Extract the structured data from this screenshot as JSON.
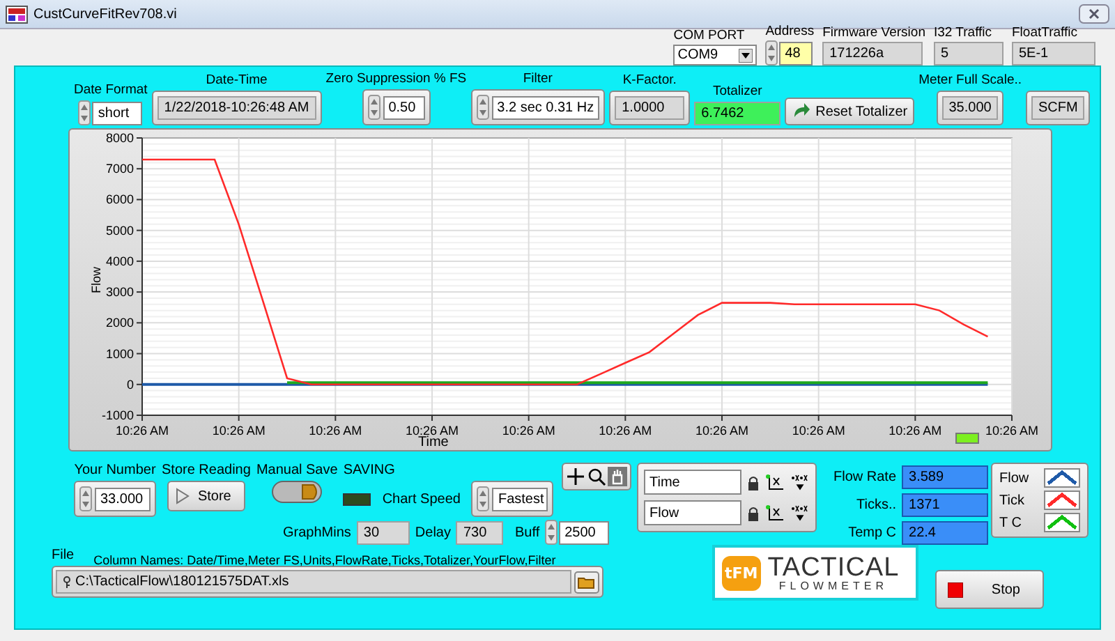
{
  "window": {
    "title": "CustCurveFitRev708.vi"
  },
  "header": [
    {
      "kind": "dropdown",
      "label": "COM PORT",
      "value": "COM9"
    },
    {
      "kind": "spin",
      "label": "Address",
      "value": "48"
    },
    {
      "kind": "readout",
      "label": "Firmware Version",
      "value": "171226a"
    },
    {
      "kind": "readout",
      "label": "I32 Traffic",
      "value": "5"
    },
    {
      "kind": "readout",
      "label": "FloatTraffic",
      "value": "5E-1"
    }
  ],
  "top_controls": [
    {
      "kind": "spin",
      "label": "Date Format",
      "value": "short"
    },
    {
      "kind": "readout",
      "label": "Date-Time",
      "value": "1/22/2018-10:26:48 AM"
    },
    {
      "kind": "spinbox",
      "label": "Zero Suppression % FS",
      "value": "0.50"
    },
    {
      "kind": "spinbox",
      "label": "Filter",
      "value": "3.2 sec 0.31 Hz"
    },
    {
      "kind": "readout",
      "label": "K-Factor.",
      "value": "1.0000"
    },
    {
      "kind": "highlight",
      "label": "Totalizer",
      "value": "6.7462"
    },
    {
      "kind": "button",
      "label": "Reset Totalizer"
    },
    {
      "kind": "readout",
      "label": "Meter Full Scale..",
      "value": "35.000"
    },
    {
      "kind": "readout",
      "value": "SCFM"
    }
  ],
  "chart": {
    "led_on": true,
    "chart_data": {
      "type": "line",
      "xlabel": "Time",
      "ylabel": "Flow",
      "categories": [
        "10:26 AM",
        null,
        null,
        null,
        "10:26 AM",
        null,
        null,
        null,
        "10:26 AM",
        null,
        null,
        null,
        "10:26 AM",
        null,
        null,
        null,
        "10:26 AM",
        null,
        null,
        null,
        "10:26 AM",
        null,
        null,
        null,
        "10:26 AM",
        null,
        null,
        null,
        "10:26 AM",
        null,
        null,
        null,
        "10:26 AM",
        null,
        null,
        null,
        "10:26 AM"
      ],
      "series": [
        {
          "color": "#1f5aa8",
          "values": [
            0,
            0,
            0,
            0,
            0,
            0,
            0,
            0,
            0,
            0,
            0,
            0,
            0,
            0,
            0,
            0,
            0,
            0,
            0,
            0,
            0,
            0,
            0,
            0,
            0,
            0,
            0,
            0,
            0,
            0,
            0,
            0,
            0,
            0,
            0,
            0,
            null
          ]
        },
        {
          "color": "#ff2a2a",
          "values": [
            7300,
            7300,
            7300,
            7300,
            5200,
            2700,
            200,
            0,
            0,
            0,
            0,
            0,
            0,
            0,
            0,
            0,
            0,
            0,
            0,
            350,
            700,
            1050,
            1650,
            2250,
            2650,
            2650,
            2650,
            2600,
            2600,
            2600,
            2600,
            2600,
            2600,
            2400,
            1950,
            1550,
            null
          ]
        },
        {
          "color": "#1fa81f",
          "values": [
            null,
            null,
            null,
            null,
            null,
            null,
            60,
            60,
            60,
            60,
            60,
            60,
            60,
            60,
            60,
            60,
            60,
            60,
            60,
            60,
            60,
            60,
            60,
            60,
            60,
            60,
            60,
            60,
            60,
            60,
            60,
            60,
            60,
            60,
            60,
            60,
            null
          ]
        }
      ],
      "ylim": [
        -1000,
        8000
      ],
      "grid": true,
      "yticks": [
        -1000,
        0,
        1000,
        2000,
        3000,
        4000,
        5000,
        6000,
        7000,
        8000
      ]
    }
  },
  "your_number": {
    "label": "Your Number",
    "value": "33.000"
  },
  "store_reading": {
    "label": "Store Reading",
    "button": "Store"
  },
  "manual_save": {
    "label": "Manual Save",
    "on": false
  },
  "saving": {
    "label": "SAVING",
    "on": false
  },
  "chart_speed": {
    "label": "Chart Speed",
    "value": "Fastest"
  },
  "graph_mins": {
    "label": "GraphMins",
    "value": "30"
  },
  "delay": {
    "label": "Delay",
    "value": "730"
  },
  "buff": {
    "label": "Buff",
    "value": "2500"
  },
  "file": {
    "label": "File",
    "column_names": "Column Names: Date/Time,Meter FS,Units,FlowRate,Ticks,Totalizer,YourFlow,Filter",
    "path": "C:\\TacticalFlow\\180121575DAT.xls"
  },
  "scales": [
    {
      "name": "Time"
    },
    {
      "name": "Flow"
    }
  ],
  "readouts": [
    {
      "label": "Flow Rate",
      "value": "3.589"
    },
    {
      "label": "Ticks..",
      "value": "1371"
    },
    {
      "label": "Temp C",
      "value": "22.4"
    }
  ],
  "logo": {
    "mark": "tFM",
    "name": "TACTICAL",
    "subtitle": "FLOWMETER"
  },
  "legend": [
    {
      "name": "Flow",
      "color": "#1f5aa8"
    },
    {
      "name": "Tick",
      "color": "#ff2a2a"
    },
    {
      "name": "T C",
      "color": "#10c010"
    }
  ],
  "stop_button": {
    "label": "Stop"
  }
}
